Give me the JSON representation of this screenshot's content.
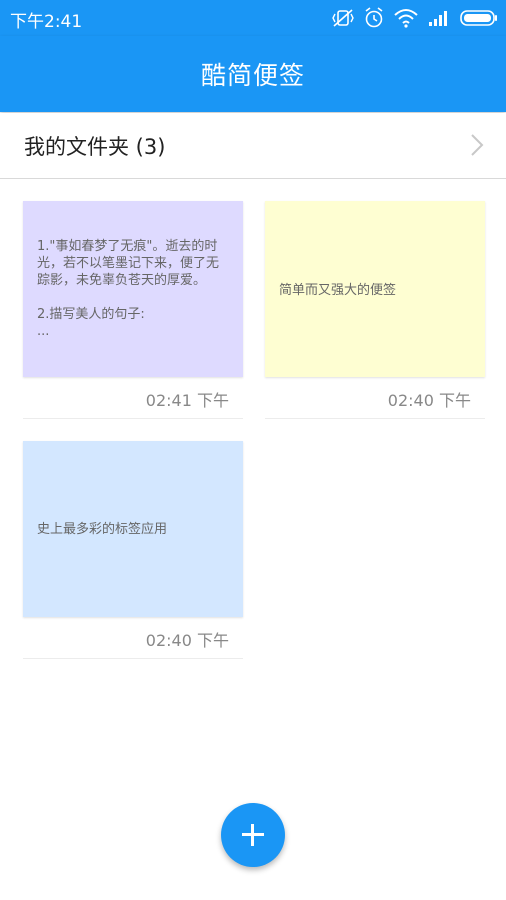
{
  "status_bar": {
    "time": "下午2:41",
    "icons": [
      "vibrate-off-icon",
      "alarm-icon",
      "wifi-icon",
      "signal-icon",
      "battery-icon"
    ]
  },
  "app_bar": {
    "title": "酷简便签"
  },
  "folder": {
    "label": "我的文件夹 (3)"
  },
  "notes": [
    {
      "text": "1.\"事如春梦了无痕\"。逝去的时光，若不以笔墨记下来，便了无踪影，未免辜负苍天的厚爱。\n\n2.描写美人的句子:\n...",
      "time": "02:41 下午",
      "color": "#dedaff"
    },
    {
      "text": "简单而又强大的便签",
      "time": "02:40 下午",
      "color": "#fefed2"
    },
    {
      "text": "史上最多彩的标签应用",
      "time": "02:40 下午",
      "color": "#d3e7ff"
    }
  ],
  "fab": {
    "icon": "plus-icon"
  },
  "colors": {
    "primary": "#1a96f5"
  }
}
